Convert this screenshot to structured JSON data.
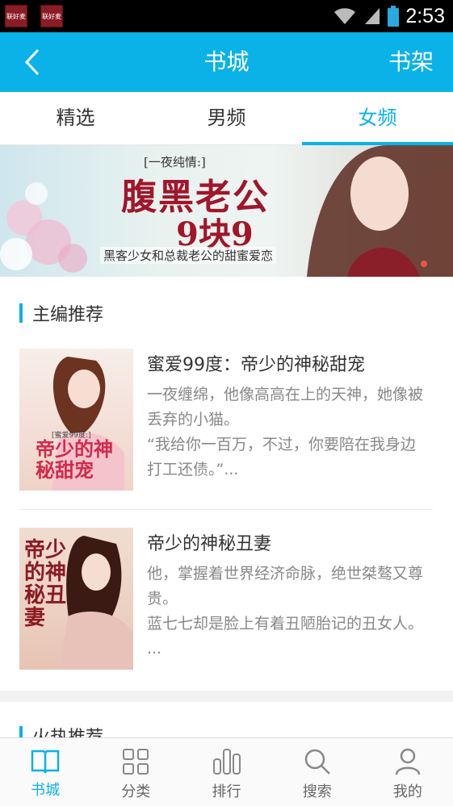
{
  "status_bar": {
    "notif1": "联好麦",
    "notif2": "联好麦",
    "time": "2:53"
  },
  "header": {
    "title": "书城",
    "shelf_label": "书架"
  },
  "tabs": [
    {
      "label": "精选"
    },
    {
      "label": "男频"
    },
    {
      "label": "女频"
    }
  ],
  "banner": {
    "tag": "[一夜纯情:]",
    "headline": "腹黑老公",
    "price": "9块9",
    "subtitle": "黑客少女和总裁老公的甜蜜爱恋"
  },
  "section_editor": {
    "title": "主编推荐"
  },
  "books": [
    {
      "title": "蜜爱99度：帝少的神秘甜宠",
      "desc": "一夜缠绵，他像高高在上的天神，她像被丢弃的小猫。\n“我给你一百万，不过，你要陪在我身边打工还债。”...",
      "cover_text": "帝少的神秘甜宠",
      "cover_tag": "[蜜爱99度:]"
    },
    {
      "title": "帝少的神秘丑妻",
      "desc": "他，掌握着世界经济命脉，绝世桀骜又尊贵。\n蓝七七却是脸上有着丑陋胎记的丑女人。 ...",
      "cover_text": "帝少的神秘丑妻"
    }
  ],
  "section_hot": {
    "title": "火热推荐"
  },
  "bottom_nav": [
    {
      "label": "书城",
      "icon": "book-open-icon"
    },
    {
      "label": "分类",
      "icon": "grid-icon"
    },
    {
      "label": "排行",
      "icon": "bar-chart-icon"
    },
    {
      "label": "搜索",
      "icon": "search-icon"
    },
    {
      "label": "我的",
      "icon": "user-icon"
    }
  ],
  "colors": {
    "accent": "#0ab2e8",
    "status_bar": "#000000"
  }
}
